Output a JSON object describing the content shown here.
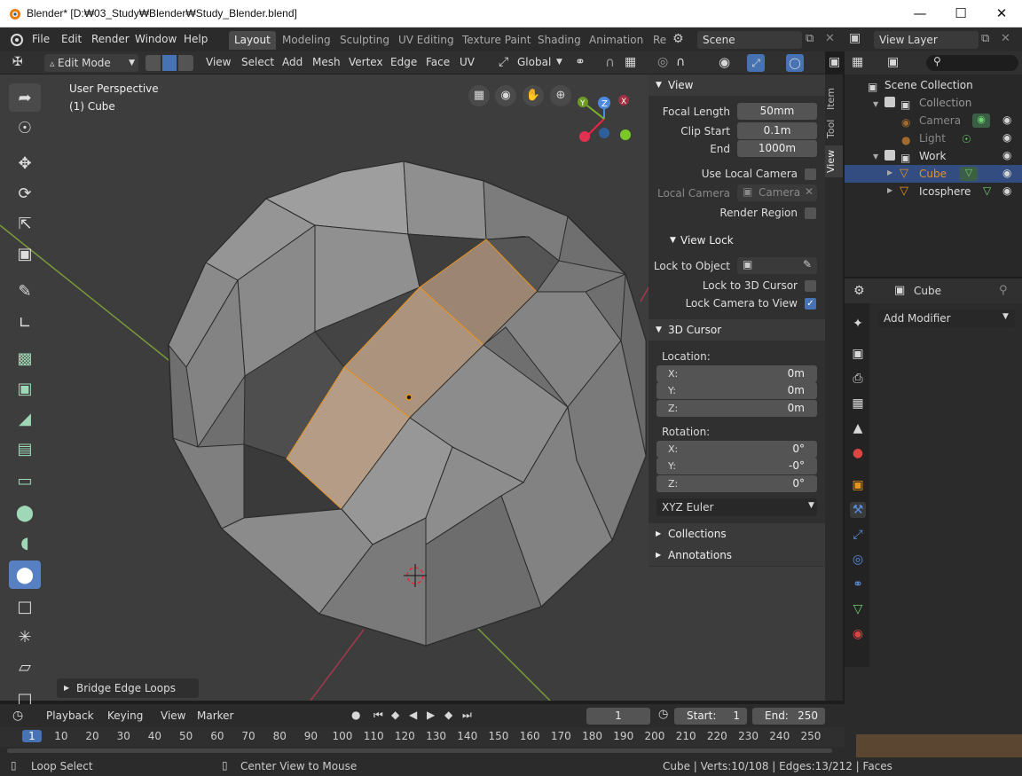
{
  "window": {
    "title": "Blender* [D:₩03_Study₩Blender₩Study_Blender.blend]"
  },
  "menu": [
    "File",
    "Edit",
    "Render",
    "Window",
    "Help"
  ],
  "workspaces": [
    "Layout",
    "Modeling",
    "Sculpting",
    "UV Editing",
    "Texture Paint",
    "Shading",
    "Animation",
    "Re"
  ],
  "scene": "Scene",
  "view_layer": "View Layer",
  "header": {
    "mode": "Edit Mode",
    "items": [
      "View",
      "Select",
      "Add",
      "Mesh",
      "Vertex",
      "Edge",
      "Face",
      "UV"
    ],
    "orientation": "Global"
  },
  "viewport": {
    "perspective": "User Perspective",
    "object": "(1) Cube",
    "operator": "Bridge Edge Loops"
  },
  "npanel": {
    "tabs": [
      "Item",
      "Tool",
      "View"
    ],
    "view_title": "View",
    "focal_label": "Focal Length",
    "focal_value": "50mm",
    "clip_start_label": "Clip Start",
    "clip_start_value": "0.1m",
    "end_label": "End",
    "end_value": "1000m",
    "use_local_camera": "Use Local Camera",
    "local_camera_label": "Local Camera",
    "local_camera_value": "Camera",
    "render_region": "Render Region",
    "view_lock": "View Lock",
    "lock_to_object": "Lock to Object",
    "lock_to_cursor": "Lock to 3D Cursor",
    "lock_camera": "Lock Camera to View",
    "cursor_title": "3D Cursor",
    "location": "Location:",
    "loc_x": "0m",
    "loc_y": "0m",
    "loc_z": "0m",
    "rotation": "Rotation:",
    "rot_x": "0°",
    "rot_y": "-0°",
    "rot_z": "0°",
    "rot_mode": "XYZ Euler",
    "collections": "Collections",
    "annotations": "Annotations",
    "x": "X:",
    "y": "Y:",
    "z": "Z:"
  },
  "outliner": {
    "scene_collection": "Scene Collection",
    "collection": "Collection",
    "camera": "Camera",
    "light": "Light",
    "work": "Work",
    "cube": "Cube",
    "icosphere": "Icosphere"
  },
  "properties": {
    "object": "Cube",
    "add_modifier": "Add Modifier"
  },
  "timeline": {
    "playback": "Playback",
    "keying": "Keying",
    "view": "View",
    "marker": "Marker",
    "current_frame": "1",
    "start_label": "Start:",
    "start": "1",
    "end_label": "End:",
    "end": "250",
    "ruler": [
      "1",
      "10",
      "20",
      "30",
      "40",
      "50",
      "60",
      "70",
      "80",
      "90",
      "100",
      "110",
      "120",
      "130",
      "140",
      "150",
      "160",
      "170",
      "180",
      "190",
      "200",
      "210",
      "220",
      "230",
      "240",
      "250"
    ]
  },
  "status": {
    "left": "Loop Select",
    "middle": "Center View to Mouse",
    "right": "Cube | Verts:10/108 | Edges:13/212 | Faces"
  },
  "colors": {
    "accent": "#4772b3",
    "selection": "#e8931e",
    "active_tool": "#5680c2"
  }
}
